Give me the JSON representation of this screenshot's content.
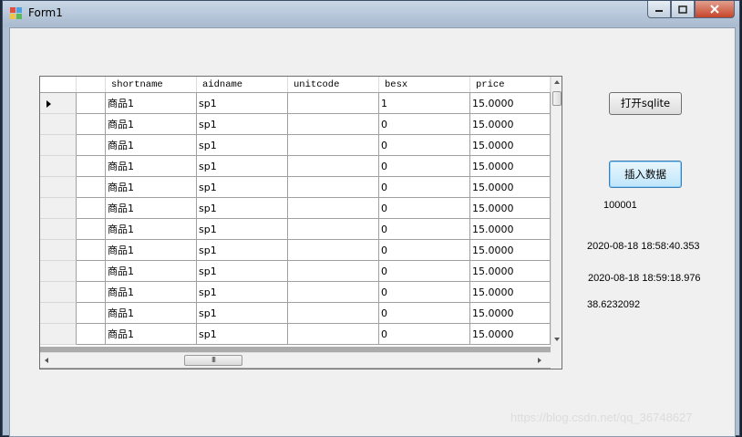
{
  "window": {
    "title": "Form1"
  },
  "grid": {
    "columns": [
      "shortname",
      "aidname",
      "unitcode",
      "besx",
      "price"
    ],
    "rows": [
      [
        "商品1",
        "sp1",
        "",
        "1",
        "15.0000"
      ],
      [
        "商品1",
        "sp1",
        "",
        "0",
        "15.0000"
      ],
      [
        "商品1",
        "sp1",
        "",
        "0",
        "15.0000"
      ],
      [
        "商品1",
        "sp1",
        "",
        "0",
        "15.0000"
      ],
      [
        "商品1",
        "sp1",
        "",
        "0",
        "15.0000"
      ],
      [
        "商品1",
        "sp1",
        "",
        "0",
        "15.0000"
      ],
      [
        "商品1",
        "sp1",
        "",
        "0",
        "15.0000"
      ],
      [
        "商品1",
        "sp1",
        "",
        "0",
        "15.0000"
      ],
      [
        "商品1",
        "sp1",
        "",
        "0",
        "15.0000"
      ],
      [
        "商品1",
        "sp1",
        "",
        "0",
        "15.0000"
      ],
      [
        "商品1",
        "sp1",
        "",
        "0",
        "15.0000"
      ],
      [
        "商品1",
        "sp1",
        "",
        "0",
        "15.0000"
      ]
    ],
    "hscroll_thumb": "III"
  },
  "buttons": {
    "open_sqlite": "打开sqlite",
    "insert_data": "插入数据"
  },
  "labels": {
    "count": "100001",
    "start_time": "2020-08-18 18:58:40.353",
    "end_time": "2020-08-18 18:59:18.976",
    "elapsed": "38.6232092"
  },
  "watermark": "https://blog.csdn.net/qq_36748627"
}
